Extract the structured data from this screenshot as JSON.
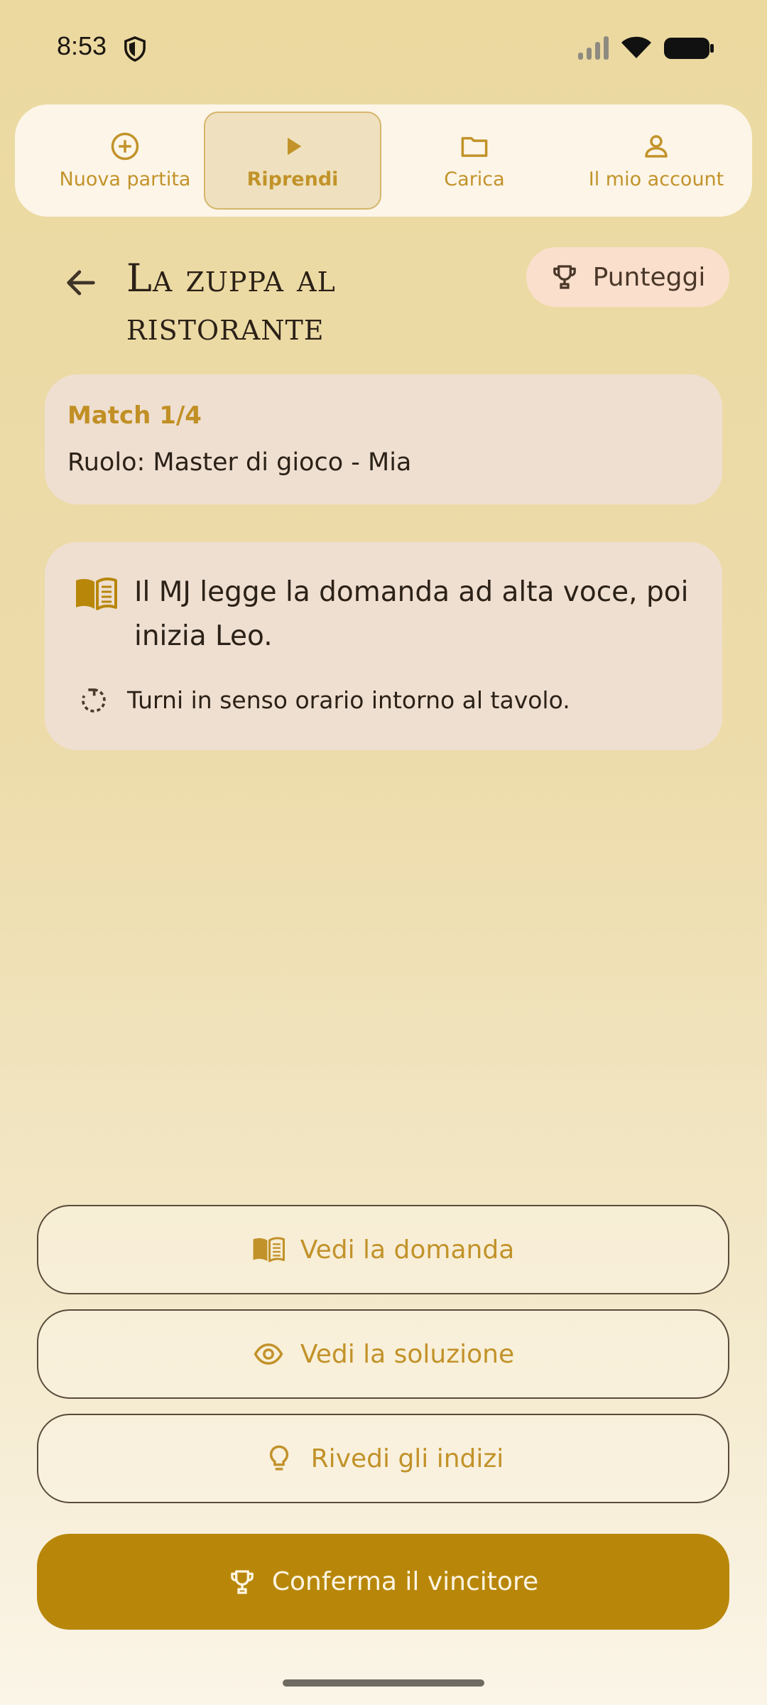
{
  "status": {
    "time": "8:53"
  },
  "nav": {
    "items": [
      {
        "label": "Nuova partita",
        "icon": "plus-circle-icon"
      },
      {
        "label": "Riprendi",
        "icon": "play-icon",
        "active": true
      },
      {
        "label": "Carica",
        "icon": "folder-icon"
      },
      {
        "label": "Il mio account",
        "icon": "user-icon"
      }
    ]
  },
  "header": {
    "title": "La zuppa al ristorante",
    "scores_label": "Punteggi"
  },
  "match": {
    "label": "Match 1/4",
    "role": "Ruolo: Master di gioco - Mia"
  },
  "info": {
    "instruction": "Il MJ legge la domanda ad alta voce, poi inizia Leo.",
    "turns": "Turni in senso orario intorno al tavolo."
  },
  "actions": {
    "question": "Vedi la domanda",
    "solution": "Vedi la soluzione",
    "clues": "Rivedi gli indizi",
    "confirm": "Conferma il vincitore"
  },
  "colors": {
    "accent": "#b8870a",
    "nav_text": "#c2932a",
    "card_bg": "#efdfd1",
    "scores_bg": "#fbdfcd"
  }
}
